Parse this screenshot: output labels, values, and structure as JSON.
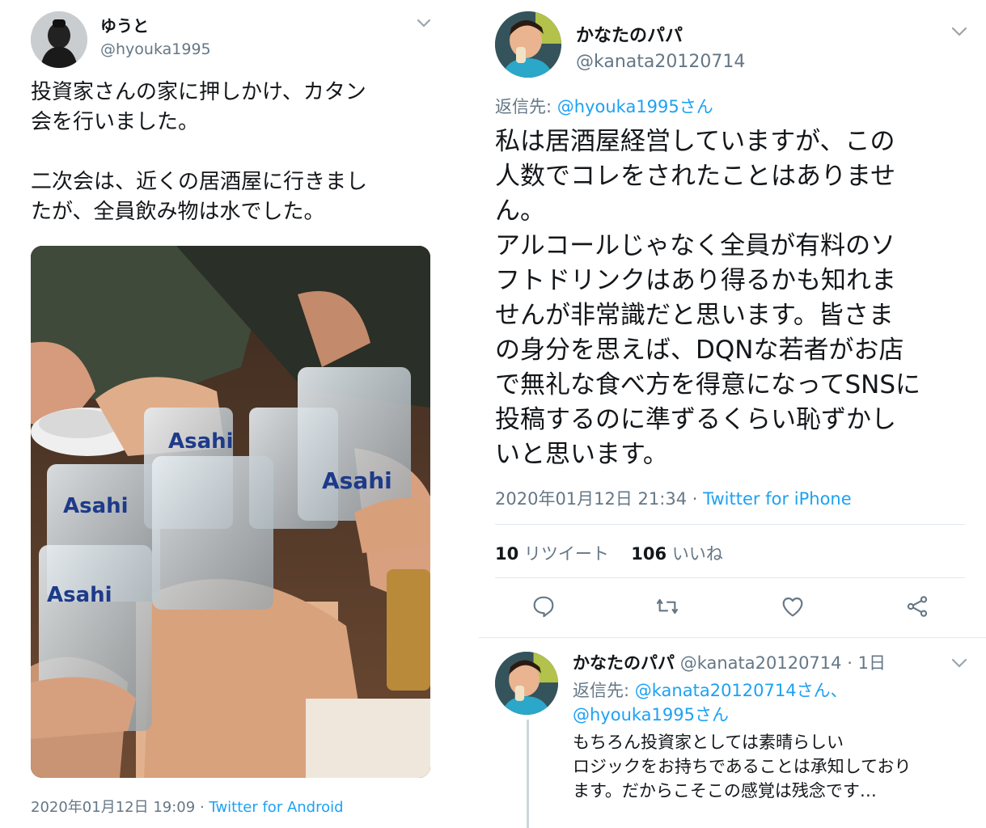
{
  "left_tweet": {
    "display_name": "ゆうと",
    "handle": "@hyouka1995",
    "text_lines": [
      "投資家さんの家に押しかけ、カタン",
      "会を行いました。",
      "",
      "二次会は、近くの居酒屋に行きまし",
      "たが、全員飲み物は水でした。"
    ],
    "timestamp": "2020年01月12日 19:09",
    "source": "Twitter for Android",
    "source_separator": "·"
  },
  "main_tweet": {
    "display_name": "かなたのパパ",
    "handle": "@kanata20120714",
    "reply_label": "返信先:",
    "reply_to": "@hyouka1995さん",
    "text_lines": [
      "私は居酒屋経営していますが、この",
      "人数でコレをされたことはありませ",
      "ん。",
      "アルコールじゃなく全員が有料のソ",
      "フトドリンクはあり得るかも知れま",
      "せんが非常識だと思います。皆さま",
      "の身分を思えば、DQNな若者がお店",
      "で無礼な食べ方を得意になってSNSに",
      "投稿するのに準ずるくらい恥ずかし",
      "いと思います。"
    ],
    "timestamp": "2020年01月12日 21:34",
    "source": "Twitter for iPhone",
    "source_separator": "·",
    "retweets_count": "10",
    "retweets_label": "リツイート",
    "likes_count": "106",
    "likes_label": "いいね"
  },
  "reply_tweet": {
    "display_name": "かなたのパパ",
    "handle": "@kanata20120714",
    "age_separator": "·",
    "age": "1日",
    "reply_label": "返信先:",
    "reply_to_1": "@kanata20120714さん、",
    "reply_to_2": "@hyouka1995さん",
    "text_lines": [
      "もちろん投資家としては素晴らしい",
      "ロジックをお持ちであることは承知しており",
      "ます。だからこそこの感覚は残念です…"
    ]
  },
  "icons": {
    "chevron": "chevron-down-icon",
    "reply": "reply-icon",
    "retweet": "retweet-icon",
    "like": "heart-icon",
    "share": "share-icon"
  },
  "colors": {
    "link": "#1da1f2",
    "secondary_text": "#657786",
    "primary_text": "#14171a",
    "divider": "#e1e8ed"
  }
}
